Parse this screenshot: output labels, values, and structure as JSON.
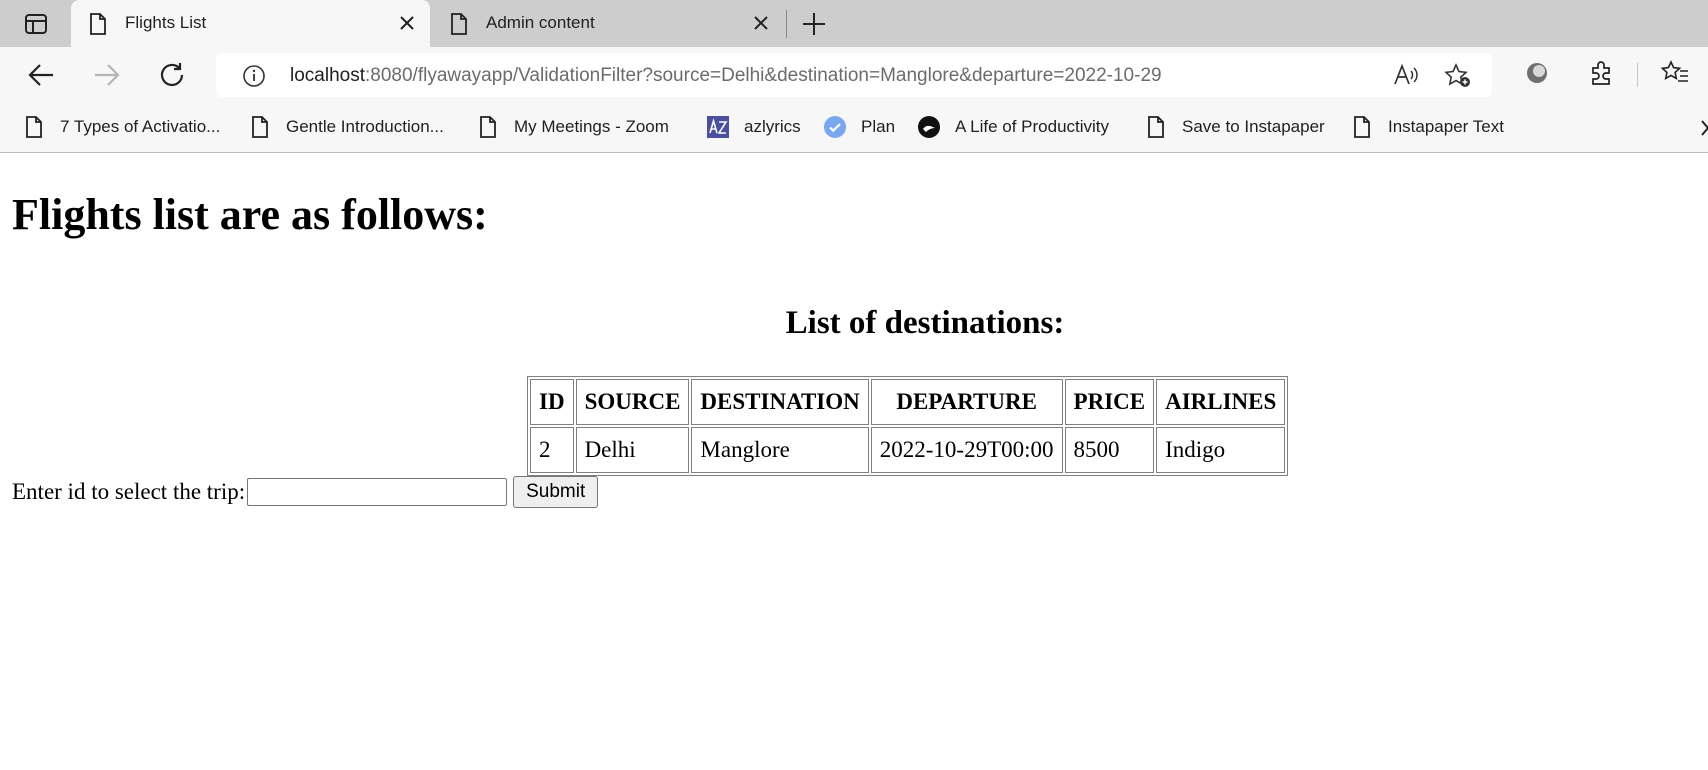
{
  "tabs": [
    {
      "title": "Flights List",
      "active": true
    },
    {
      "title": "Admin content",
      "active": false
    }
  ],
  "address_bar": {
    "host": "localhost",
    "rest": ":8080/flyawayapp/ValidationFilter?source=Delhi&destination=Manglore&departure=2022-10-29"
  },
  "bookmarks": [
    {
      "label": "7 Types of Activatio...",
      "icon": "page-icon"
    },
    {
      "label": "Gentle Introduction...",
      "icon": "page-icon"
    },
    {
      "label": "My Meetings - Zoom",
      "icon": "page-icon"
    },
    {
      "label": "azlyrics",
      "icon": "azlyrics-icon"
    },
    {
      "label": "Plan",
      "icon": "check-circle-icon"
    },
    {
      "label": "A Life of Productivity",
      "icon": "circle-logo-icon"
    },
    {
      "label": "Save to Instapaper",
      "icon": "page-icon"
    },
    {
      "label": "Instapaper Text",
      "icon": "page-icon"
    }
  ],
  "page": {
    "heading": "Flights list are as follows:",
    "table_title": "List of destinations:",
    "columns": [
      "ID",
      "SOURCE",
      "DESTINATION",
      "DEPARTURE",
      "PRICE",
      "AIRLINES"
    ],
    "rows": [
      [
        "2",
        "Delhi",
        "Manglore",
        "2022-10-29T00:00",
        "8500",
        "Indigo"
      ]
    ],
    "form_label": "Enter id to select the trip:",
    "input_value": "",
    "submit_label": "Submit"
  },
  "colors": {
    "tabstrip": "#cdcdcd",
    "toolbar": "#f7f7f7",
    "plan_icon": "#7aa7f0"
  }
}
